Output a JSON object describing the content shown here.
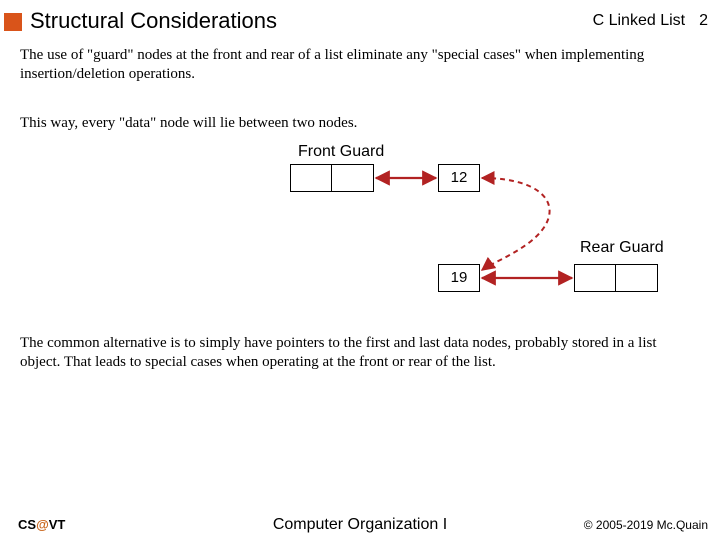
{
  "header": {
    "title": "Structural Considerations",
    "topic": "C Linked List",
    "page_number": "2"
  },
  "paragraphs": {
    "p1": "The use of \"guard\" nodes at the front and rear of a list eliminate any \"special cases\" when implementing insertion/deletion operations.",
    "p2": "This way, every \"data\" node will lie between two nodes.",
    "p3": "The common alternative is to simply have pointers to the first and last data nodes, probably stored in a list object.  That leads to special cases when operating at the front or rear of the list."
  },
  "diagram": {
    "front_guard_label": "Front Guard",
    "rear_guard_label": "Rear Guard",
    "node1_value": "12",
    "node2_value": "19"
  },
  "footer": {
    "left_pre": "CS",
    "left_at": "@",
    "left_post": "VT",
    "center": "Computer Organization I",
    "right": "© 2005-2019 Mc.Quain"
  }
}
